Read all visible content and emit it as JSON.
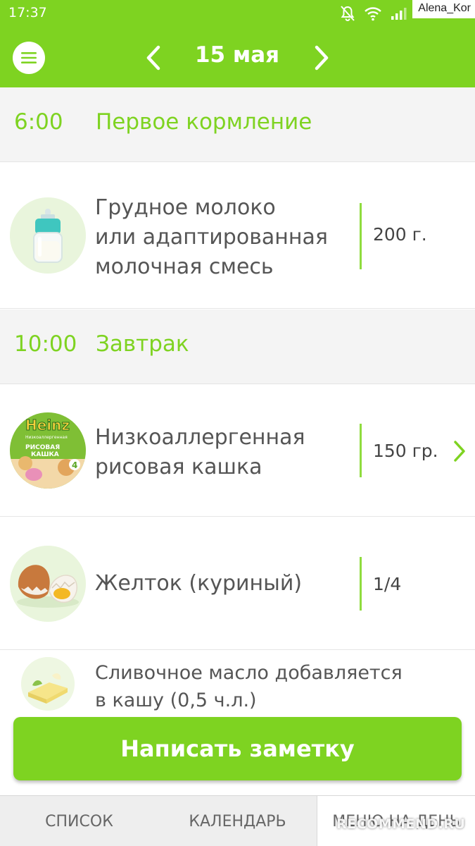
{
  "status_bar": {
    "time": "17:37",
    "user": "Alena_Kor"
  },
  "header": {
    "date": "15 мая",
    "menu_icon": "hamburger-icon",
    "prev_icon": "chevron-left-icon",
    "next_icon": "chevron-right-icon"
  },
  "meals": [
    {
      "time": "6:00",
      "name": "Первое кормление",
      "items": [
        {
          "name_lines": [
            "Грудное молоко",
            "или адаптированная",
            "молочная смесь"
          ],
          "amount": "200 г.",
          "icon": "baby-bottle-icon"
        }
      ]
    },
    {
      "time": "10:00",
      "name": "Завтрак",
      "items": [
        {
          "name_lines": [
            "Низкоаллергенная",
            "рисовая кашка"
          ],
          "amount": "150 гр.",
          "icon": "porridge-box-icon",
          "package_brand": "Heinz",
          "package_text": [
            "Низкоаллергенная",
            "РИСОВАЯ",
            "КАШКА"
          ],
          "package_badge": "4",
          "has_chevron": true
        },
        {
          "name_lines": [
            "Желток (куриный)"
          ],
          "amount": "1/4",
          "icon": "egg-icon"
        }
      ],
      "note": {
        "lines": [
          "Сливочное масло добавляется",
          "в кашу (0,5 ч.л.)"
        ],
        "icon": "butter-icon"
      }
    }
  ],
  "actions": {
    "write_note": "Написать заметку"
  },
  "tabs": [
    {
      "label": "СПИСОК"
    },
    {
      "label": "КАЛЕНДАРЬ"
    },
    {
      "label": "МЕНЮ НА ДЕНЬ",
      "active": true
    }
  ],
  "watermark": "RECOMMEND.RU",
  "colors": {
    "accent": "#7ed321",
    "divider": "#8fdc3e",
    "section_bg": "#f4f4f4",
    "text": "#555555"
  }
}
